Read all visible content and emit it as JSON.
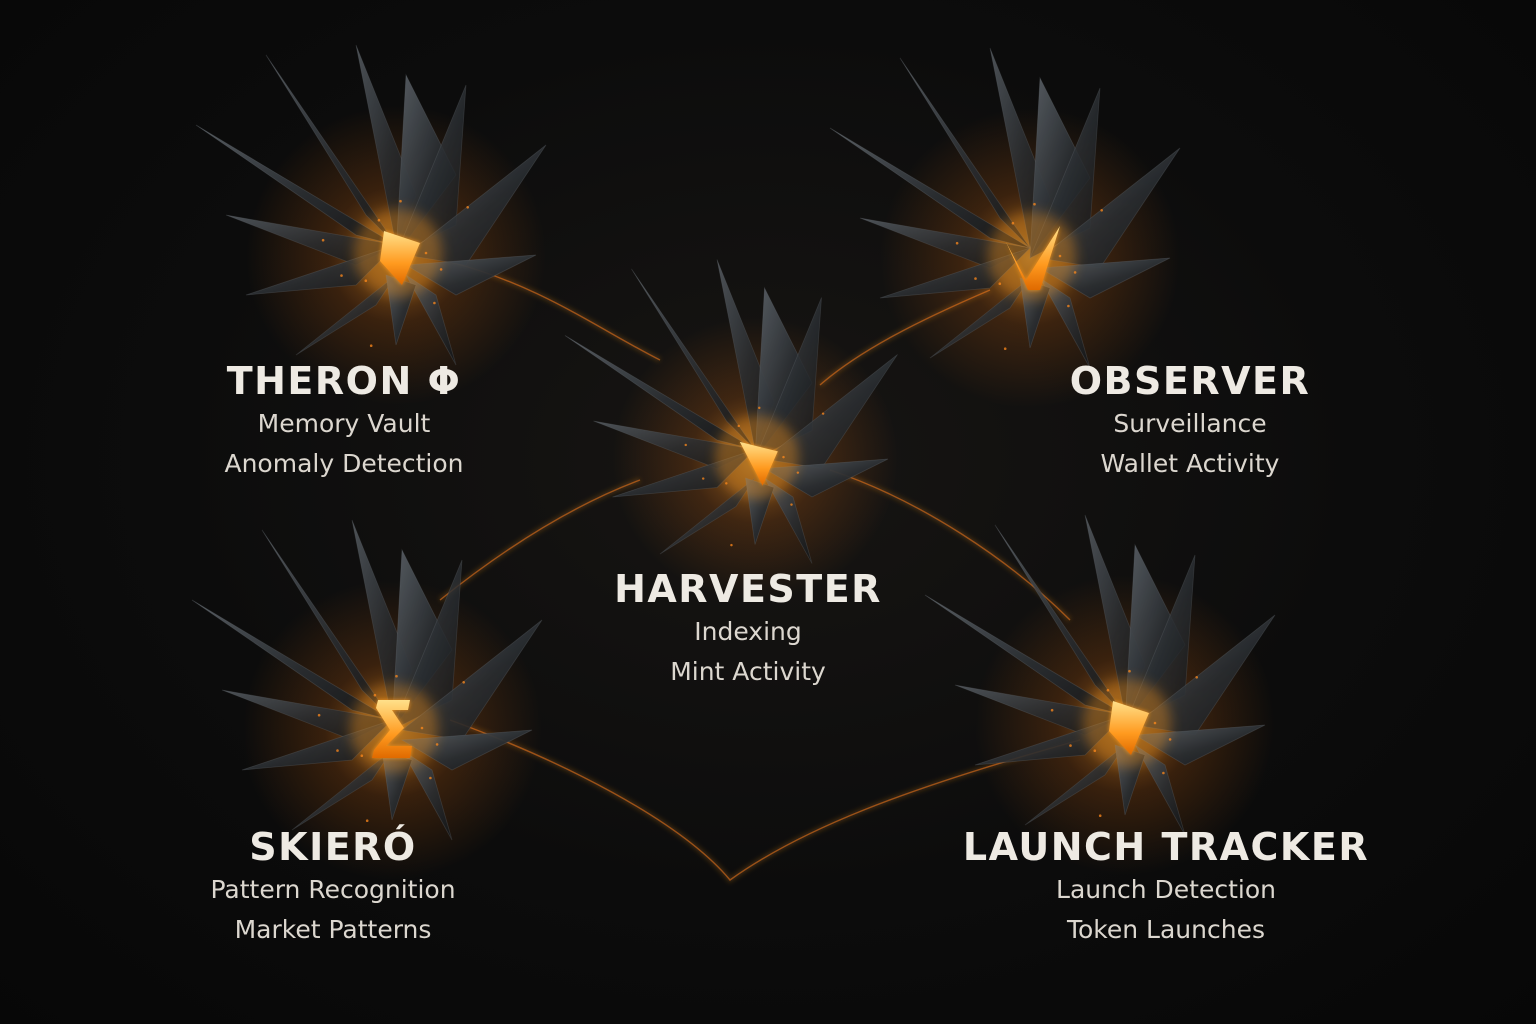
{
  "agents": [
    {
      "id": "theron",
      "name": "THERON Φ",
      "role": "Memory Vault",
      "focus": "Anomaly Detection",
      "core_glyph": "shard"
    },
    {
      "id": "observer",
      "name": "OBSERVER",
      "role": "Surveillance",
      "focus": "Wallet Activity",
      "core_glyph": "check"
    },
    {
      "id": "harvester",
      "name": "HARVESTER",
      "role": "Indexing",
      "focus": "Mint Activity",
      "core_glyph": "triangle"
    },
    {
      "id": "skiero",
      "name": "SKIERÓ",
      "role": "Pattern Recognition",
      "focus": "Market Patterns",
      "core_glyph": "sigma"
    },
    {
      "id": "launch-tracker",
      "name": "LAUNCH TRACKER",
      "role": "Launch Detection",
      "focus": "Token Launches",
      "core_glyph": "shard"
    }
  ],
  "connections": [
    [
      "theron",
      "harvester"
    ],
    [
      "observer",
      "harvester"
    ],
    [
      "harvester",
      "skiero"
    ],
    [
      "harvester",
      "launch-tracker"
    ],
    [
      "skiero",
      "launch-tracker"
    ]
  ],
  "colors": {
    "background": "#0b0b0b",
    "crystal": "#2b2f33",
    "crystal_highlight": "#6e747a",
    "glow": "#ff9a1f",
    "glow_core": "#ffd36b",
    "text": "#eeeae3"
  }
}
